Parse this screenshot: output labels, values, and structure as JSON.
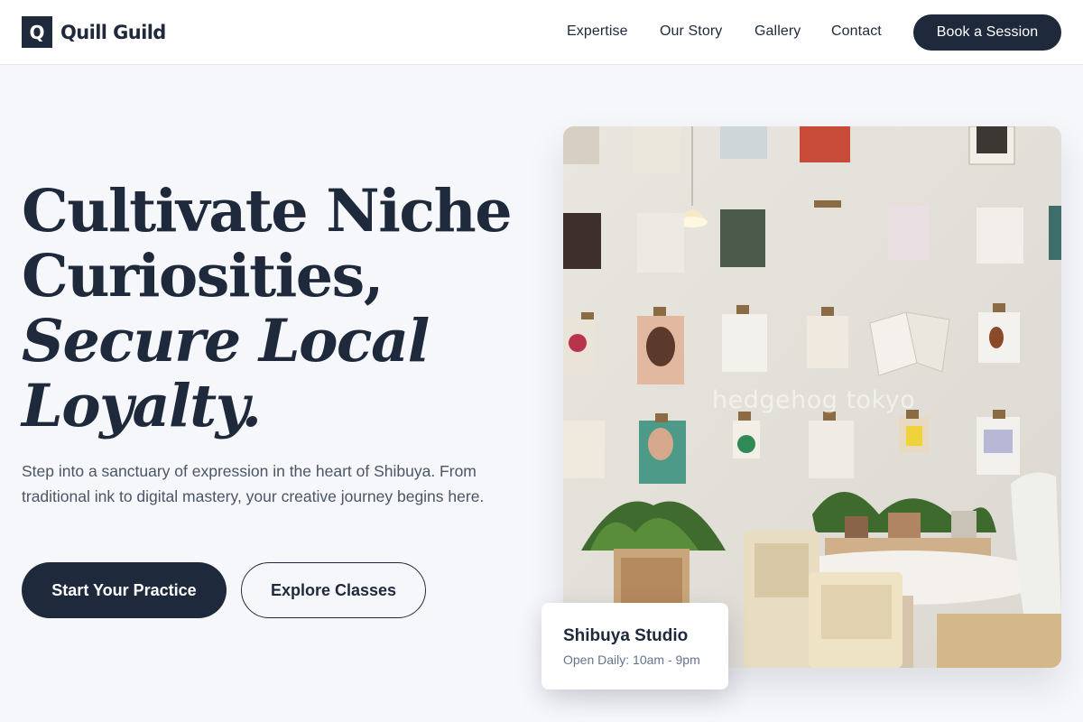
{
  "brand": {
    "logo_letter": "Q",
    "name": "Quill Guild"
  },
  "nav": {
    "links": [
      {
        "label": "Expertise"
      },
      {
        "label": "Our Story"
      },
      {
        "label": "Gallery"
      },
      {
        "label": "Contact"
      }
    ],
    "cta_label": "Book a Session"
  },
  "hero": {
    "title_line1": "Cultivate Niche",
    "title_line2": "Curiosities,",
    "title_line3": "Secure Local",
    "title_line4": "Loyalty.",
    "subtitle": "Step into a sanctuary of expression in the heart of Shibuya. From traditional ink to digital mastery, your creative journey begins here.",
    "primary_cta": "Start Your Practice",
    "secondary_cta": "Explore Classes"
  },
  "image": {
    "watermark": "hedgehog tokyo",
    "description_icon": "studio-photo"
  },
  "studio_card": {
    "title": "Shibuya Studio",
    "hours": "Open Daily: 10am - 9pm"
  },
  "colors": {
    "primary": "#1e293b",
    "background": "#f6f7fb",
    "muted_text": "#4b5563",
    "card_sub_text": "#64748b"
  }
}
